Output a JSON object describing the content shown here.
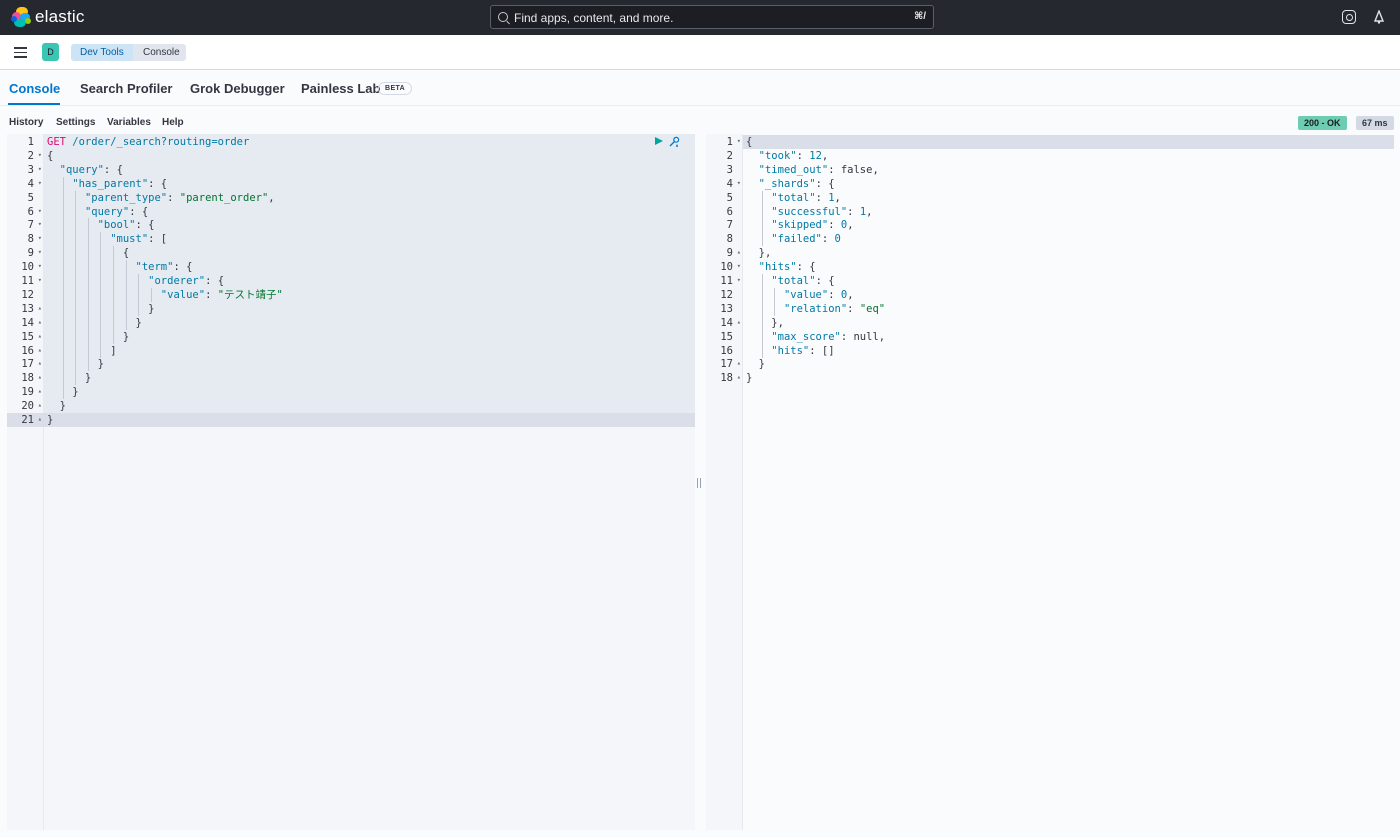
{
  "header": {
    "logo_text": "elastic",
    "search_placeholder": "Find apps, content, and more.",
    "search_shortcut": "⌘/"
  },
  "breadcrumbs": {
    "space_initial": "D",
    "items": [
      "Dev Tools",
      "Console"
    ]
  },
  "tabs": [
    {
      "label": "Console",
      "active": true
    },
    {
      "label": "Search Profiler",
      "active": false
    },
    {
      "label": "Grok Debugger",
      "active": false
    },
    {
      "label": "Painless Lab",
      "active": false
    }
  ],
  "beta_label": "BETA",
  "topnav": [
    "History",
    "Settings",
    "Variables",
    "Help"
  ],
  "response_status": "200 - OK",
  "response_time": "67 ms",
  "request": {
    "method": "GET",
    "path": " /order/_search?routing=order",
    "lines": [
      "{",
      "  \"query\": {",
      "    \"has_parent\": {",
      "      \"parent_type\": \"parent_order\",",
      "      \"query\": {",
      "        \"bool\": {",
      "          \"must\": [",
      "            {",
      "              \"term\": {",
      "                \"orderer\": {",
      "                  \"value\": \"テスト靖子\"",
      "                }",
      "              }",
      "            }",
      "          ]",
      "        }",
      "      }",
      "    }",
      "  }",
      "}"
    ]
  },
  "response": {
    "lines": [
      "{",
      "  \"took\": 12,",
      "  \"timed_out\": false,",
      "  \"_shards\": {",
      "    \"total\": 1,",
      "    \"successful\": 1,",
      "    \"skipped\": 0,",
      "    \"failed\": 0",
      "  },",
      "  \"hits\": {",
      "    \"total\": {",
      "      \"value\": 0,",
      "      \"relation\": \"eq\"",
      "    },",
      "    \"max_score\": null,",
      "    \"hits\": []",
      "  }",
      "}"
    ]
  },
  "colors": {
    "accent": "#0077cc",
    "status_ok": "#6dccb1",
    "string": "#00752f",
    "key": "#0079a5",
    "method": "#dd0a73"
  }
}
